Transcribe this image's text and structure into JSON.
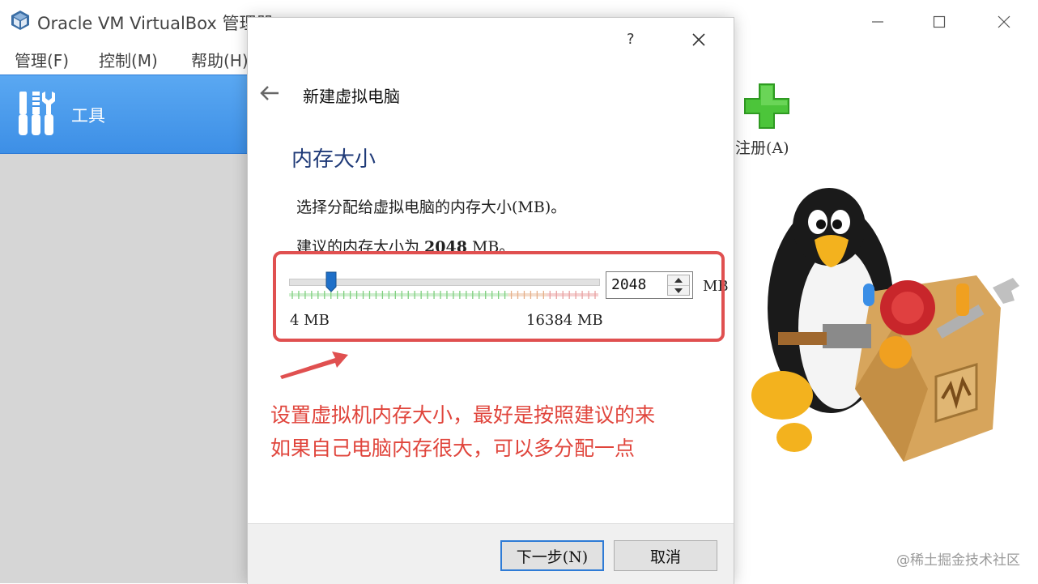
{
  "window": {
    "title": "Oracle VM VirtualBox 管理器",
    "icons": [
      "virtualbox-logo",
      "minimize-icon",
      "maximize-icon",
      "close-icon"
    ]
  },
  "menu": [
    "管理(F)",
    "控制(M)",
    "帮助(H)"
  ],
  "sidebar": {
    "tools_label": "工具",
    "tools_icon": "tools-icon"
  },
  "toolbar": {
    "register_label": "注册(A)",
    "register_icon": "green-plus-icon"
  },
  "dialog": {
    "help": "?",
    "wizard_title": "新建虚拟电脑",
    "section_title": "内存大小",
    "description": "选择分配给虚拟电脑的内存大小(MB)。",
    "recommend_prefix": "建议的内存大小为 ",
    "recommend_value": "2048",
    "recommend_suffix": " MB。",
    "slider": {
      "min_label": "4 MB",
      "max_label": "16384 MB",
      "value": 2048,
      "min": 4,
      "max": 16384
    },
    "spin_value": "2048",
    "unit": "MB",
    "buttons": {
      "next": "下一步(N)",
      "cancel": "取消"
    }
  },
  "annotation": {
    "line1": "设置虚拟机内存大小，最好是按照建议的来",
    "line2": "如果自己电脑内存很大，可以多分配一点",
    "color": "#e0453c"
  },
  "watermark": "@稀土掘金技术社区"
}
